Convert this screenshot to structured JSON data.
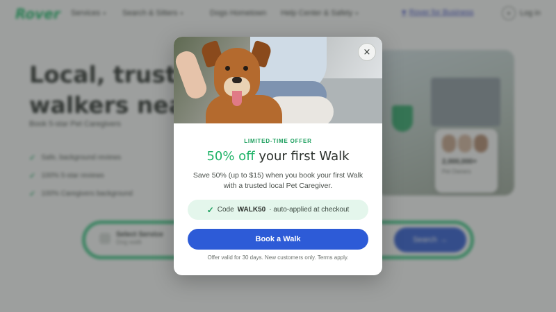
{
  "nav": {
    "logo": "Rover",
    "items": [
      "Services",
      "Search & Sitters",
      "Dogs Hometown",
      "Help Center & Safety"
    ],
    "for_business": "Rover for Business",
    "login": "Log in"
  },
  "hero": {
    "title_line1": "Local, trusted",
    "title_line2": "walkers near",
    "subtitle": "Book 5-star Pet Caregivers",
    "checklist": [
      "Safe, background reviews",
      "100% 5-star reviews",
      "100% Caregivers background"
    ]
  },
  "search": {
    "field_label": "Select Service",
    "field_value": "Dog walk",
    "button_label": "Search"
  },
  "review_card": {
    "count": "2,000,000+",
    "note": "Pet Owners"
  },
  "modal": {
    "close_glyph": "×",
    "eyebrow": "LIMITED-TIME OFFER",
    "headline_accent": "50% off",
    "headline_rest": " your first Walk",
    "body": "Save 50% (up to $15) when you book your first Walk with a trusted local Pet Caregiver.",
    "code_prefix": "Code",
    "code": "WALK50",
    "code_suffix": "· auto-applied at checkout",
    "cta": "Book a Walk",
    "fine_print": "Offer valid for 30 days. New customers only. Terms apply."
  },
  "colors": {
    "brand_green": "#1fb368",
    "cta_blue": "#2d5bd7",
    "pill_bg": "#e4f6ec"
  },
  "icons": {
    "close": "close-icon",
    "check": "check-icon"
  }
}
